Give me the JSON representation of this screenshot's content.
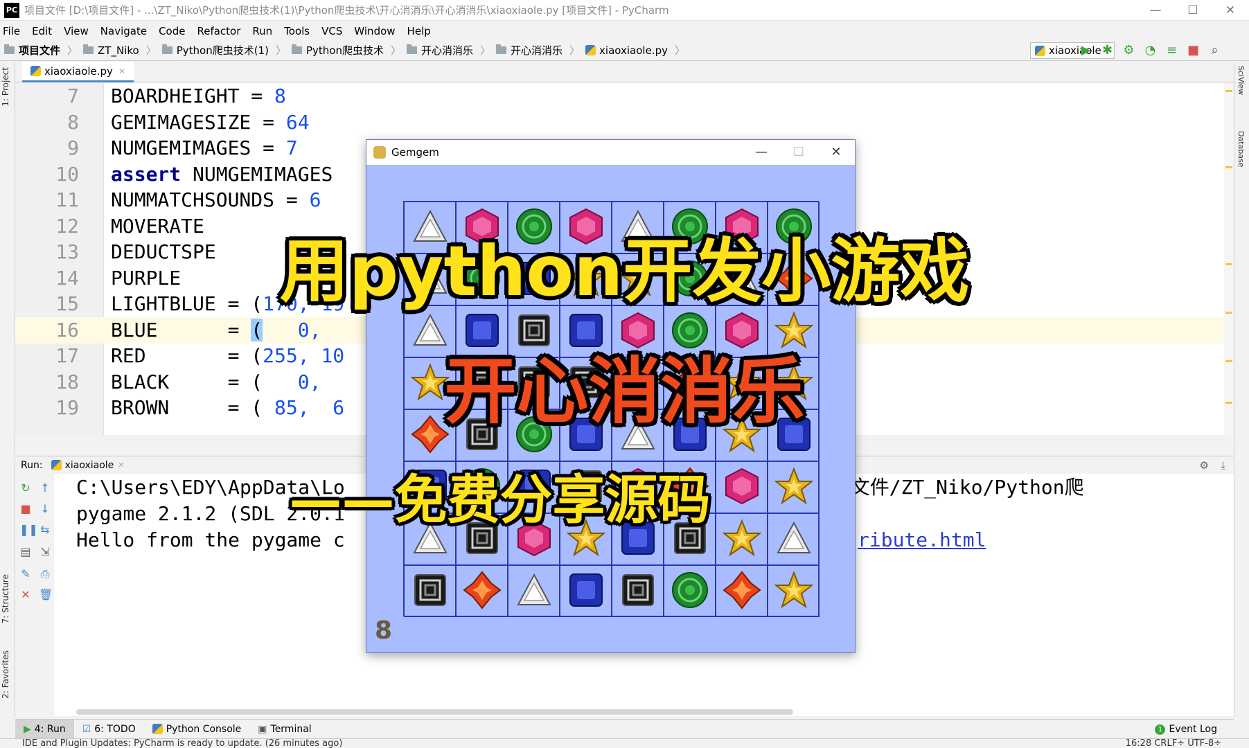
{
  "window": {
    "title": "项目文件 [D:\\项目文件] - ...\\ZT_Niko\\Python爬虫技术(1)\\Python爬虫技术\\开心消消乐\\开心消消乐\\xiaoxiaole.py [项目文件] - PyCharm",
    "app_icon": "PC"
  },
  "menu": [
    "File",
    "Edit",
    "View",
    "Navigate",
    "Code",
    "Refactor",
    "Run",
    "Tools",
    "VCS",
    "Window",
    "Help"
  ],
  "breadcrumbs": [
    "项目文件",
    "ZT_Niko",
    "Python爬虫技术(1)",
    "Python爬虫技术",
    "开心消消乐",
    "开心消消乐",
    "xiaoxiaole.py"
  ],
  "run_config": "xiaoxiaole",
  "side_labels": {
    "project": "1: Project",
    "structure": "7: Structure",
    "favorites": "2: Favorites",
    "sciview": "SciView",
    "database": "Database"
  },
  "editor": {
    "tab": "xiaoxiaole.py",
    "lines": [
      {
        "n": "7",
        "t": "BOARDHEIGHT = ",
        "v": "8",
        "r": ""
      },
      {
        "n": "8",
        "t": "GEMIMAGESIZE = ",
        "v": "64",
        "r": ""
      },
      {
        "n": "9",
        "t": "NUMGEMIMAGES = ",
        "v": "7",
        "r": ""
      },
      {
        "n": "10",
        "kw": "assert",
        "t": " NUMGEMIMAGES",
        "v": "",
        "r": ""
      },
      {
        "n": "11",
        "t": "NUMMATCHSOUNDS = ",
        "v": "6",
        "r": ""
      },
      {
        "n": "12",
        "t": "MOVERATE",
        "v": "",
        "r": ""
      },
      {
        "n": "13",
        "t": "DEDUCTSPE",
        "v": "",
        "r": ""
      },
      {
        "n": "14",
        "t": "PURPLE",
        "v": "",
        "r": ""
      },
      {
        "n": "15",
        "t": "LIGHTBLUE = (",
        "v": "170, 19",
        "r": ""
      },
      {
        "n": "16",
        "t": "BLUE      = ",
        "hl": "(",
        "v": "   0,",
        "r": ""
      },
      {
        "n": "17",
        "t": "RED       = (",
        "v": "255, 10",
        "r": ""
      },
      {
        "n": "18",
        "t": "BLACK     = (",
        "v": "   0,",
        "r": ""
      },
      {
        "n": "19",
        "t": "BROWN     = (",
        "v": " 85,  6",
        "r": ""
      }
    ]
  },
  "run_panel": {
    "label": "Run:",
    "tab": "xiaoxiaole",
    "console": [
      {
        "a": "C:\\Users\\EDY\\AppData\\Lo",
        "b": ":/项目文件/ZT_Niko/Python爬"
      },
      {
        "a": "pygame 2.1.2 (SDL 2.0.1",
        "b": ""
      },
      {
        "a": "Hello from the pygame c",
        "b": "ribute.html"
      }
    ]
  },
  "bottom_tabs": [
    {
      "label": "4: Run",
      "icon": "run-icon"
    },
    {
      "label": "6: TODO",
      "icon": "todo-icon"
    },
    {
      "label": "Python Console",
      "icon": "python-icon"
    },
    {
      "label": "Terminal",
      "icon": "terminal-icon"
    }
  ],
  "event_log": "Event Log",
  "status": {
    "message": "IDE and Plugin Updates: PyCharm is ready to update. (26 minutes ago)",
    "right": "16:28  CRLF÷  UTF-8÷"
  },
  "game": {
    "title": "Gemgem",
    "score": "8",
    "bg_color": "#a8bcff",
    "grid": [
      [
        "triangle",
        "hexagon",
        "sphere",
        "hexagon",
        "triangle",
        "sphere",
        "hexagon",
        "sphere"
      ],
      [
        "triangle",
        "sphere",
        "square",
        "star",
        "star",
        "sphere",
        "triangle",
        "diamond"
      ],
      [
        "triangle",
        "square",
        "spiral",
        "square",
        "hexagon",
        "sphere",
        "hexagon",
        "star"
      ],
      [
        "star",
        "spiral",
        "spiral",
        "spiral",
        "spiral",
        "diamond",
        "star",
        "star"
      ],
      [
        "diamond",
        "spiral",
        "sphere",
        "square",
        "triangle",
        "square",
        "star",
        "square"
      ],
      [
        "square",
        "sphere",
        "square",
        "spiral",
        "hexagon",
        "diamond",
        "hexagon",
        "star"
      ],
      [
        "triangle",
        "spiral",
        "hexagon",
        "star",
        "square",
        "spiral",
        "star",
        "triangle"
      ],
      [
        "spiral",
        "diamond",
        "triangle",
        "square",
        "spiral",
        "sphere",
        "diamond",
        "star"
      ]
    ]
  },
  "overlay": {
    "line1": "用python开发小游戏",
    "line2": "开心消消乐",
    "line3": "——免费分享源码"
  }
}
